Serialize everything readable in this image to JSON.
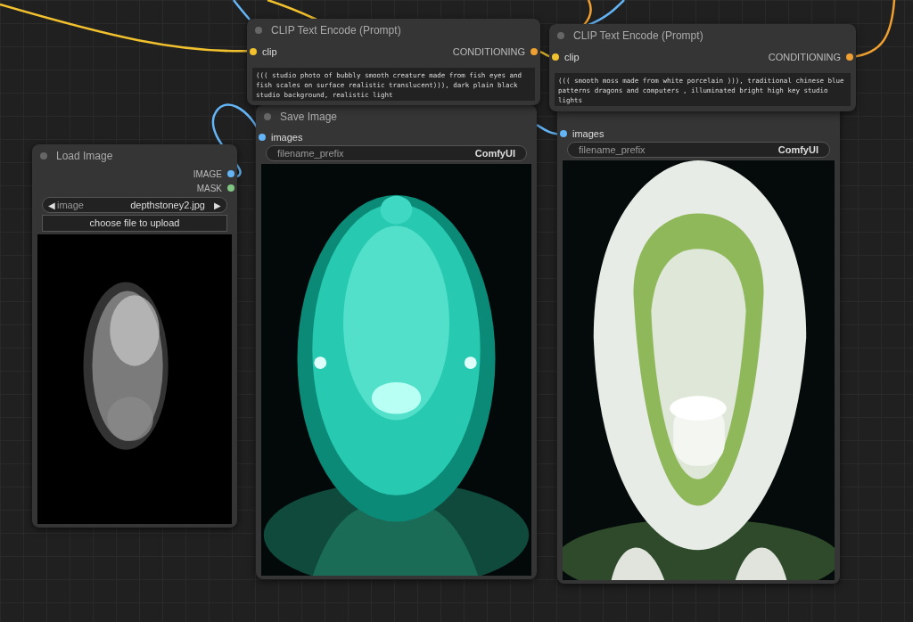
{
  "nodes": [
    {
      "kind": "clip",
      "title": "CLIP Text Encode (Prompt)",
      "inputs": [
        {
          "label": "clip",
          "color": "#f2c12e"
        }
      ],
      "outputs": [
        {
          "label": "CONDITIONING",
          "color": "#f0a030"
        }
      ],
      "text": "((( studio photo of bubbly smooth creature made from fish eyes and fish scales on surface realistic translucent))), dark plain black studio background, realistic light"
    },
    {
      "kind": "clip",
      "title": "CLIP Text Encode (Prompt)",
      "inputs": [
        {
          "label": "clip",
          "color": "#f2c12e"
        }
      ],
      "outputs": [
        {
          "label": "CONDITIONING",
          "color": "#f0a030"
        }
      ],
      "text": "((( smooth moss made from white porcelain ))), traditional chinese blue patterns dragons and computers , illuminated bright high key studio lights"
    },
    {
      "kind": "load",
      "title": "Load Image",
      "outputs": [
        {
          "label": "IMAGE",
          "color": "#64b5f6"
        },
        {
          "label": "MASK",
          "color": "#81c784"
        }
      ],
      "combo": {
        "left": "◀",
        "label": "image",
        "value": "depthstoney2.jpg",
        "right": "▶"
      },
      "button": "choose file to upload"
    },
    {
      "kind": "save",
      "title": "Save Image",
      "inputs": [
        {
          "label": "images",
          "color": "#64b5f6"
        }
      ],
      "widget": {
        "label": "filename_prefix",
        "value": "ComfyUI"
      }
    },
    {
      "kind": "save",
      "inputs": [
        {
          "label": "images",
          "color": "#64b5f6"
        }
      ],
      "widget": {
        "label": "filename_prefix",
        "value": "ComfyUI"
      }
    }
  ]
}
